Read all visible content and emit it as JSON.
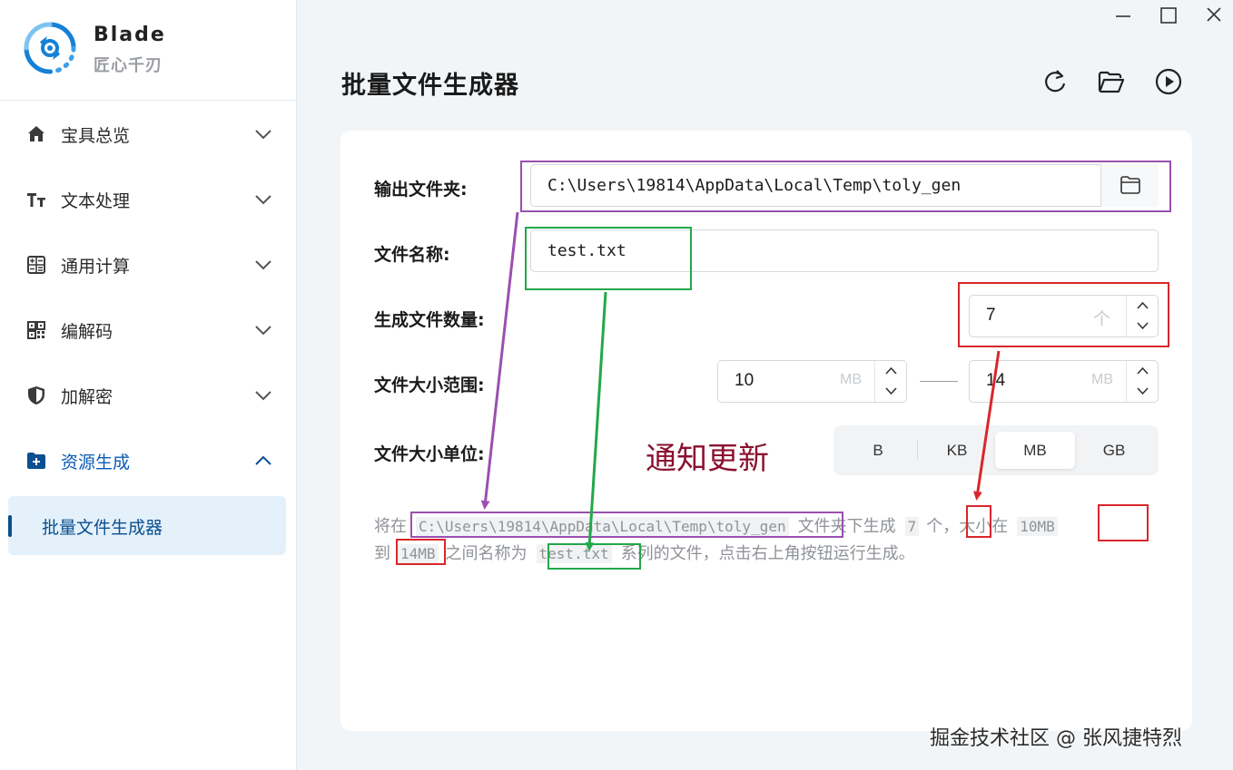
{
  "brand": {
    "name": "Blade",
    "subtitle": "匠心千刃"
  },
  "sidebar": {
    "items": [
      {
        "label": "宝具总览",
        "icon": "home-icon"
      },
      {
        "label": "文本处理",
        "icon": "text-icon"
      },
      {
        "label": "通用计算",
        "icon": "calculator-icon"
      },
      {
        "label": "编解码",
        "icon": "qrcode-icon"
      },
      {
        "label": "加解密",
        "icon": "shield-icon"
      },
      {
        "label": "资源生成",
        "icon": "folder-add-icon",
        "expanded": true
      }
    ],
    "submenu": {
      "label": "批量文件生成器",
      "selected": true
    }
  },
  "page": {
    "title": "批量文件生成器"
  },
  "toolbar": {
    "icons": [
      "refresh-icon",
      "open-folder-icon",
      "run-icon"
    ]
  },
  "form": {
    "output_folder": {
      "label": "输出文件夹:",
      "value": "C:\\Users\\19814\\AppData\\Local\\Temp\\toly_gen"
    },
    "file_name": {
      "label": "文件名称:",
      "value": "test.txt"
    },
    "file_count": {
      "label": "生成文件数量:",
      "value": "7",
      "unit": "个"
    },
    "size_range": {
      "label": "文件大小范围:",
      "min": "10",
      "max": "14",
      "unit": "MB"
    },
    "size_unit": {
      "label": "文件大小单位:",
      "options": [
        "B",
        "KB",
        "MB",
        "GB"
      ],
      "selected": "MB"
    }
  },
  "description": {
    "p1": "将在",
    "folder": "C:\\Users\\19814\\AppData\\Local\\Temp\\toly_gen",
    "p2": "文件夹下生成",
    "count": "7",
    "p3": "个，大小在",
    "min": "10MB",
    "p4": "到",
    "max": "14MB",
    "p5": "之间名称为",
    "name": "test.txt",
    "p6": "系列的文件，点击右上角按钮运行生成。"
  },
  "annotation": {
    "notice": "通知更新"
  },
  "watermark": "掘金技术社区 @ 张风捷特烈",
  "colors": {
    "accent": "#0a4f8f",
    "purple": "#9b4fb0",
    "green": "#22a84a",
    "red": "#d9262b"
  }
}
